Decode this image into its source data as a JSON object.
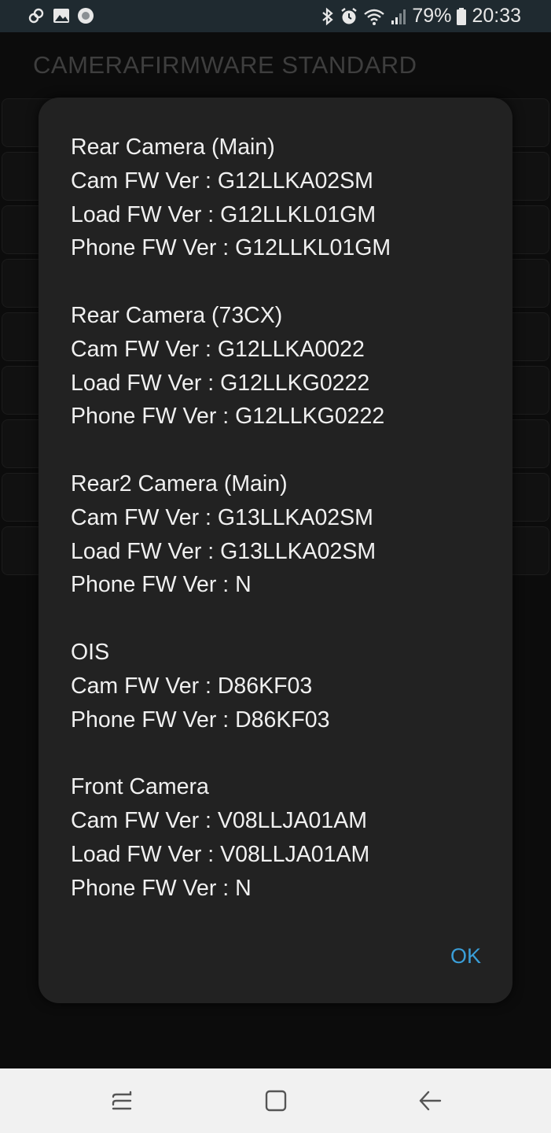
{
  "status_bar": {
    "battery": "79%",
    "time": "20:33",
    "left_icons": [
      "link-icon",
      "image-icon",
      "record-icon"
    ],
    "right_icons": [
      "bluetooth-icon",
      "alarm-icon",
      "wifi-icon",
      "signal-icon",
      "battery-icon"
    ]
  },
  "app": {
    "title": "CAMERAFIRMWARE STANDARD"
  },
  "dialog": {
    "groups": [
      {
        "heading": "Rear Camera (Main)",
        "lines": [
          "Cam FW Ver : G12LLKA02SM",
          "Load FW Ver : G12LLKL01GM",
          "Phone FW Ver : G12LLKL01GM"
        ]
      },
      {
        "heading": "Rear Camera (73CX)",
        "lines": [
          "Cam FW Ver : G12LLKA0022",
          "Load FW Ver : G12LLKG0222",
          "Phone FW Ver : G12LLKG0222"
        ]
      },
      {
        "heading": "Rear2 Camera (Main)",
        "lines": [
          "Cam FW Ver : G13LLKA02SM",
          "Load FW Ver : G13LLKA02SM",
          "Phone FW Ver : N"
        ]
      },
      {
        "heading": "OIS",
        "lines": [
          "Cam FW Ver : D86KF03",
          "Phone FW Ver : D86KF03"
        ]
      },
      {
        "heading": "Front Camera",
        "lines": [
          "Cam FW Ver : V08LLJA01AM",
          "Load FW Ver : V08LLJA01AM",
          "Phone FW Ver : N"
        ]
      }
    ],
    "ok_label": "OK"
  },
  "nav_bar": {
    "buttons": [
      "recent-apps-icon",
      "home-icon",
      "back-icon"
    ]
  },
  "colors": {
    "accent": "#3a9ed8",
    "dialog_bg": "#222222",
    "status_bar_bg": "#1f2a30"
  }
}
